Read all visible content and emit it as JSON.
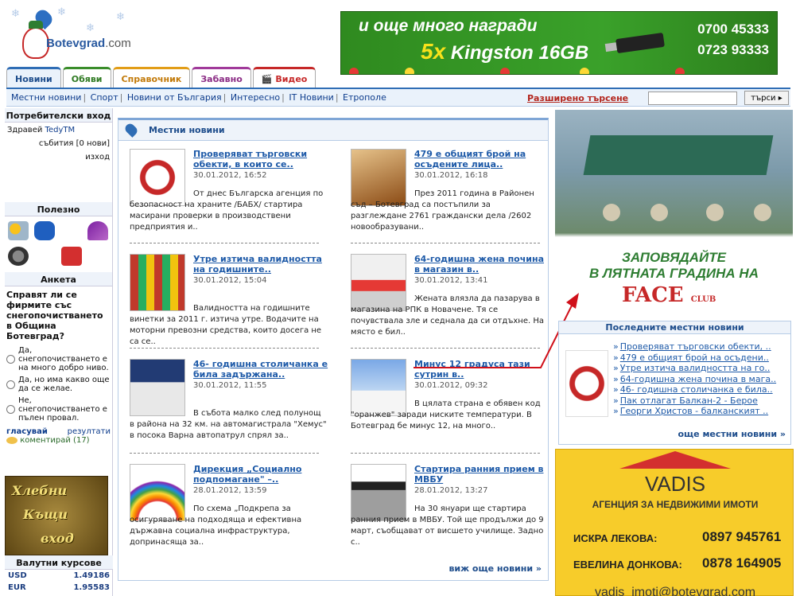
{
  "logo": {
    "text": "Botevgrad",
    "suffix": ".com"
  },
  "banner": {
    "line1": "и още много награди",
    "count": "5x",
    "product": "Kingston 16GB",
    "phone1": "0700 45333",
    "phone2": "0723 93333"
  },
  "tabs": [
    "Новини",
    "Обяви",
    "Справочник",
    "Забавно",
    "Видео"
  ],
  "subnav": {
    "links": [
      "Местни новини",
      "Спорт",
      "Новини от България",
      "Интересно",
      "IT Новини",
      "Етрополе"
    ],
    "advanced_search": "Разширено търсене",
    "search_button": "търси"
  },
  "sidebar": {
    "login_title": "Потребителски вход",
    "greeting": "Здравей",
    "username": "TedyTM",
    "events": "събития [0 нови]",
    "logout": "изход",
    "useful_title": "Полезно",
    "poll_title": "Анкета",
    "poll_question": "Справят ли се фирмите със снегопочистването в Община Ботевград?",
    "poll_options": [
      "Да, снегопочистването е на много добро ниво.",
      "Да, но има какво още да се желае.",
      "Не, снегопочистването е пълен провал."
    ],
    "vote": "гласувай",
    "results": "резултати",
    "comment": "коментирай (17)",
    "ad_lines": [
      "Хлебни",
      "Къщи",
      "вход"
    ],
    "fx_title": "Валутни курсове",
    "fx": [
      {
        "code": "USD",
        "rate": "1.49186"
      },
      {
        "code": "EUR",
        "rate": "1.95583"
      }
    ]
  },
  "main": {
    "title": "Местни новини",
    "more": "виж още новини »",
    "articles": [
      {
        "title": "Проверяват търговски обекти, в които се..",
        "date": "30.01.2012, 16:52",
        "text": "От днес Българска агенция по безопасност на храните /БАБХ/ стартира масирани проверки в производствени предприятия и.."
      },
      {
        "title": "479 е общият брой на осъдените лица..",
        "date": "30.01.2012, 16:18",
        "text": "През 2011 година в Районен съд – Ботевград са постъпили за разглеждане 2761 граждански дела /2602 новообразувани.."
      },
      {
        "title": "Утре изтича валидността на годишните..",
        "date": "30.01.2012, 15:04",
        "text": "Валидността на годишните винетки за 2011 г. изтича утре. Водачите на моторни превозни средства, които досега не са се.."
      },
      {
        "title": "64-годишна жена почина в магазин в..",
        "date": "30.01.2012, 13:41",
        "text": "Жената влязла да пазарува в магазина на РПК в Новачене. Тя се почувствала зле и седнала да си отдъхне. На място е бил.."
      },
      {
        "title": "46- годишна столичанка е била задържана..",
        "date": "30.01.2012, 11:55",
        "text": "В събота малко след полунощ в района на 32 км. на автомагистрала \"Хемус\" в посока Варна автопатрул спрял за.."
      },
      {
        "title": "Минус 12 градуса тази сутрин в..",
        "date": "30.01.2012, 09:32",
        "text": "В цялата страна е обявен код \"оранжев\" заради ниските температури. В Ботевград бе минус 12, на много.."
      },
      {
        "title": "Дирекция „Социално подпомагане\" –..",
        "date": "28.01.2012, 13:59",
        "text": "По схема „Подкрепа за осигуряване на подходяща и ефективна държавна социална инфраструктура, допринасяща за.."
      },
      {
        "title": "Стартира ранния прием в МВБУ",
        "date": "28.01.2012, 13:27",
        "text": "На 30 януари ще стартира ранния прием в МВБУ. Той ще продължи до 9 март, съобщават от висшето училище. Задно с.."
      }
    ]
  },
  "right_ad": {
    "line1": "ЗАПОВЯДАЙТЕ",
    "line2": "В ЛЯТНАТА ГРАДИНА НА",
    "brand": "FACE",
    "brand_sub": "CLUB"
  },
  "latest": {
    "title": "Последните местни новини",
    "items": [
      "Проверяват търговски обекти, ..",
      "479 е общият брой на осъдени..",
      "Утре изтича валидността на го..",
      "64-годишна жена почина в мага..",
      "46- годишна столичанка е била..",
      "Пак отлагат Балкан-2 - Берое",
      "Георги Христов - балканският .."
    ],
    "more": "още местни новини »"
  },
  "vadis": {
    "name": "VADIS",
    "subtitle": "АГЕНЦИЯ ЗА НЕДВИЖИМИ ИМОТИ",
    "people": [
      {
        "name": "ИСКРА ЛЕКОВА:",
        "phone": "0897 945761"
      },
      {
        "name": "ЕВЕЛИНА ДОНКОВА:",
        "phone": "0878 164905"
      }
    ],
    "email": "vadis_imoti@botevgrad.com"
  }
}
